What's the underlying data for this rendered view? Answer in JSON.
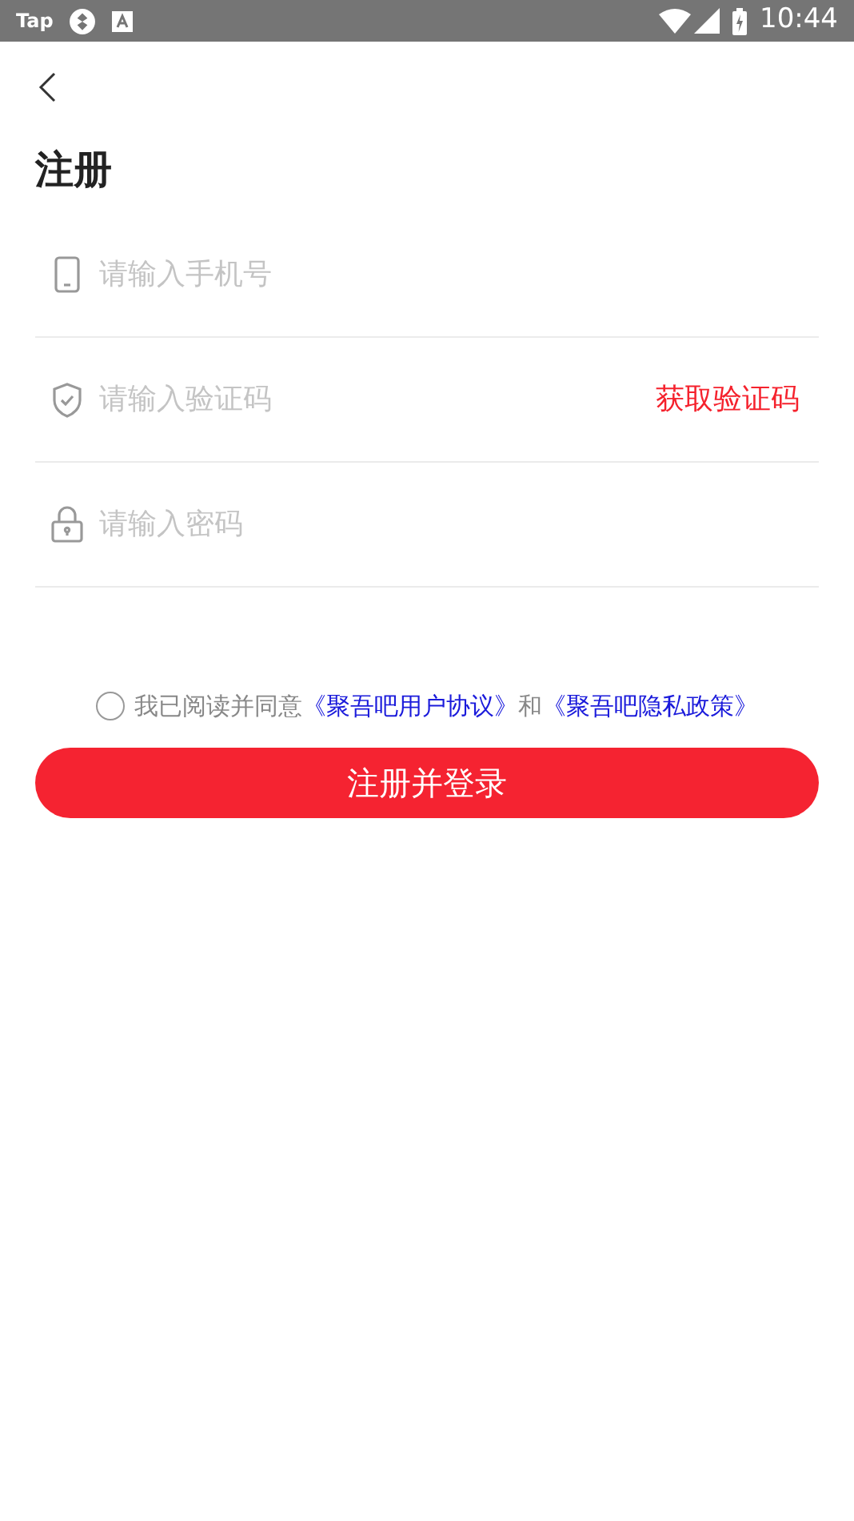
{
  "status_bar": {
    "app_label": "Tap",
    "time": "10:44"
  },
  "title": "注册",
  "fields": [
    {
      "kind": "phone",
      "placeholder": "请输入手机号"
    },
    {
      "kind": "code",
      "placeholder": "请输入验证码",
      "action": "获取验证码"
    },
    {
      "kind": "password",
      "placeholder": "请输入密码"
    }
  ],
  "agreement": {
    "checked": false,
    "text": "我已阅读并同意",
    "link_1": "《聚吾吧用户协议》",
    "joiner": "和",
    "link_2": "《聚吾吧隐私政策》"
  },
  "submit": "注册并登录"
}
